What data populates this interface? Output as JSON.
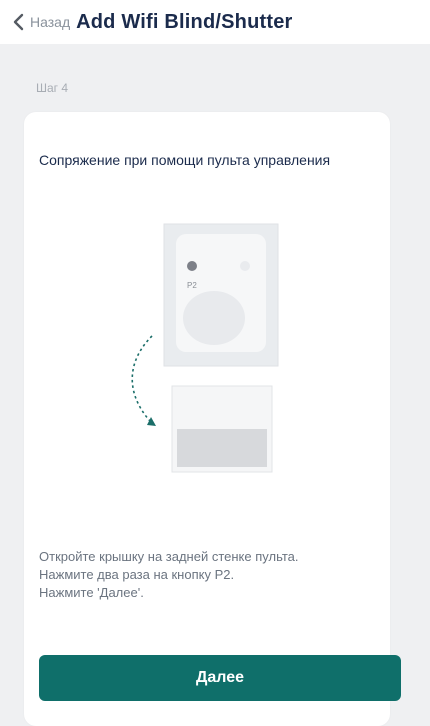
{
  "header": {
    "back_label": "Назад",
    "title": "Add Wifi Blind/Shutter"
  },
  "step_label": "Шаг 4",
  "card": {
    "title": "Сопряжение при помощи пульта управления",
    "illustration": {
      "button_label": "P2"
    },
    "instructions": [
      "Откройте крышку на задней стенке пульта.",
      "Нажмите два раза на кнопку P2.",
      "Нажмите 'Далее'."
    ]
  },
  "next_button_label": "Далее",
  "colors": {
    "accent": "#0f6f6a",
    "background": "#eff0f2",
    "title": "#1b2b4c"
  }
}
